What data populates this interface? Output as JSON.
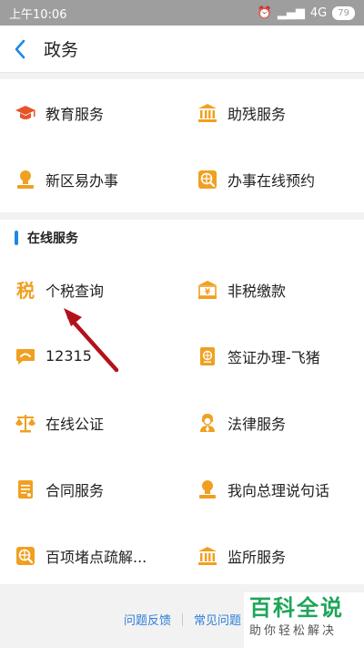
{
  "status": {
    "time": "上午10:06",
    "network": "4G",
    "battery": "79"
  },
  "nav": {
    "title": "政务"
  },
  "top_services": [
    {
      "label": "教育服务",
      "icon": "graduation-cap-icon"
    },
    {
      "label": "助残服务",
      "icon": "bank-building-icon"
    },
    {
      "label": "新区易办事",
      "icon": "person-stamp-icon"
    },
    {
      "label": "办事在线预约",
      "icon": "globe-search-icon"
    }
  ],
  "online_section": {
    "title": "在线服务",
    "items": [
      {
        "label": "个税查询",
        "icon": "tax-character-icon"
      },
      {
        "label": "非税缴款",
        "icon": "yuan-building-icon"
      },
      {
        "label": "12315",
        "icon": "phone-bubble-icon"
      },
      {
        "label": "签证办理-飞猪",
        "icon": "passport-globe-icon"
      },
      {
        "label": "在线公证",
        "icon": "scales-icon"
      },
      {
        "label": "法律服务",
        "icon": "judge-icon"
      },
      {
        "label": "合同服务",
        "icon": "contract-document-icon"
      },
      {
        "label": "我向总理说句话",
        "icon": "person-stamp-icon"
      },
      {
        "label": "百项堵点疏解...",
        "icon": "globe-search-icon"
      },
      {
        "label": "监所服务",
        "icon": "bank-building-icon"
      }
    ]
  },
  "footer": {
    "feedback": "问题反馈",
    "faq": "常见问题"
  },
  "watermark": {
    "title": "百科全说",
    "subtitle": "助你轻松解决"
  },
  "colors": {
    "accent": "#1e88e5",
    "icon_orange": "#f0a020",
    "link": "#2f7fd6",
    "edu_red": "#e8542a"
  }
}
